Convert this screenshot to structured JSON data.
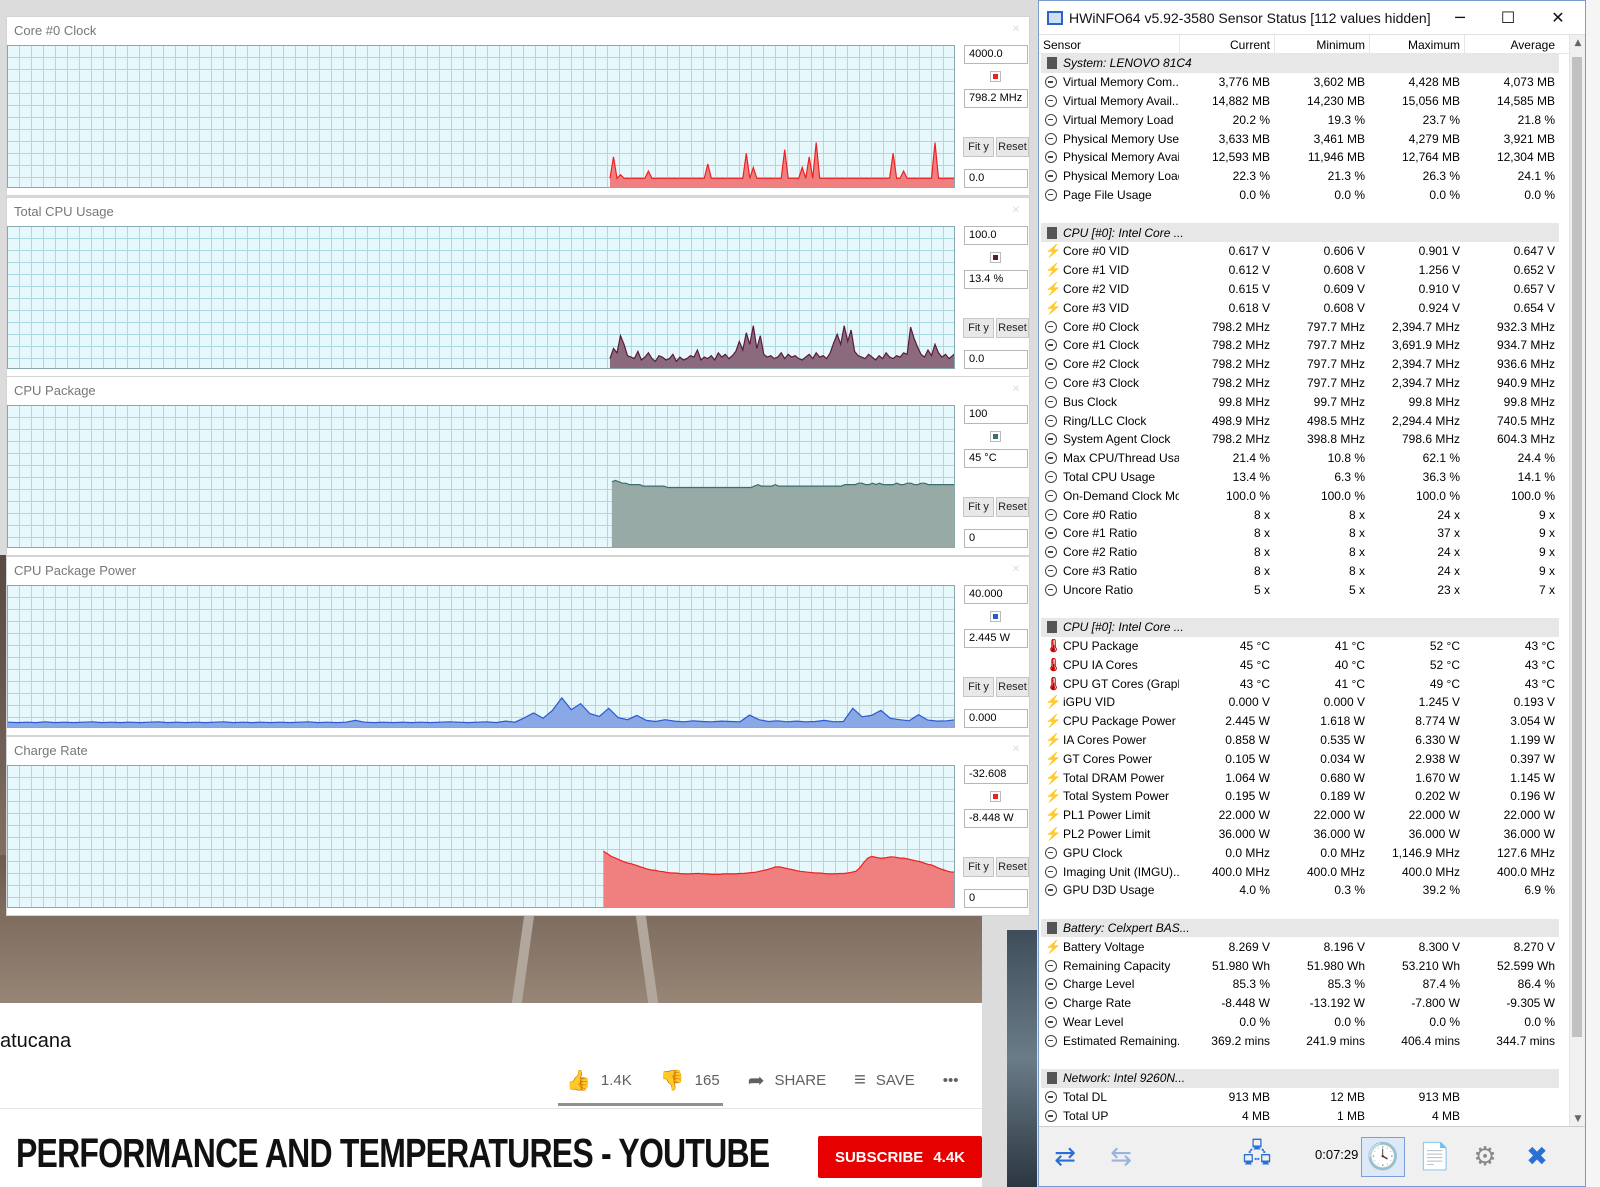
{
  "youtube": {
    "channel": "atucana",
    "likes": "1.4K",
    "dislikes": "165",
    "share": "SHARE",
    "save": "SAVE",
    "more": "•••",
    "page_title": "PERFORMANCE AND TEMPERATURES - YOUTUBE",
    "subscribe": "SUBSCRIBE",
    "subscribers": "4.4K"
  },
  "graphs": [
    {
      "title": "Core #0 Clock",
      "max": "4000.0",
      "current": "798.2 MHz",
      "min": "0.0",
      "color": "#ee2020",
      "fill": "#f08080",
      "chart_data": {
        "type": "area",
        "ylim": [
          0,
          4000
        ],
        "start_x": 0.635,
        "values": [
          300,
          900,
          300,
          400,
          300,
          300,
          300,
          300,
          300,
          300,
          300,
          500,
          300,
          300,
          300,
          300,
          300,
          300,
          300,
          300,
          300,
          300,
          300,
          300,
          300,
          300,
          300,
          300,
          700,
          300,
          300,
          300,
          300,
          300,
          300,
          300,
          300,
          300,
          300,
          1000,
          300,
          600,
          300,
          300,
          300,
          300,
          300,
          300,
          300,
          300,
          1100,
          300,
          300,
          300,
          300,
          600,
          300,
          900,
          300,
          1300,
          300,
          300,
          300,
          300,
          300,
          300,
          300,
          300,
          300,
          300,
          300,
          300,
          300,
          300,
          300,
          300,
          300,
          300,
          300,
          300,
          300,
          1000,
          300,
          300,
          500,
          300,
          300,
          300,
          300,
          300,
          300,
          300,
          300,
          1300,
          300,
          300,
          300,
          300,
          300,
          300
        ]
      }
    },
    {
      "title": "Total CPU Usage",
      "max": "100.0",
      "current": "13.4 %",
      "min": "0.0",
      "color": "#5a1a3a",
      "fill": "#8c6a7e",
      "chart_data": {
        "type": "area",
        "ylim": [
          0,
          100
        ],
        "start_x": 0.635,
        "values": [
          8,
          15,
          12,
          24,
          18,
          10,
          9,
          8,
          13,
          7,
          9,
          12,
          8,
          6,
          10,
          9,
          7,
          8,
          11,
          6,
          9,
          7,
          8,
          10,
          9,
          14,
          7,
          9,
          8,
          10,
          7,
          12,
          9,
          11,
          8,
          10,
          13,
          20,
          14,
          26,
          18,
          31,
          15,
          24,
          11,
          9,
          10,
          8,
          9,
          12,
          8,
          11,
          9,
          10,
          8,
          7,
          9,
          11,
          8,
          12,
          9,
          10,
          8,
          12,
          19,
          25,
          18,
          31,
          20,
          28,
          13,
          10,
          9,
          8,
          11,
          9,
          7,
          10,
          8,
          12,
          9,
          8,
          10,
          9,
          12,
          11,
          30,
          22,
          16,
          11,
          9,
          14,
          10,
          18,
          12,
          9,
          11,
          8,
          10,
          12
        ]
      }
    },
    {
      "title": "CPU Package",
      "max": "100",
      "current": "45 °C",
      "min": "0",
      "color": "#3c7070",
      "fill": "#97aaa6",
      "chart_data": {
        "type": "area",
        "ylim": [
          0,
          100
        ],
        "start_x": 0.637,
        "values": [
          47,
          48,
          47,
          46,
          46,
          45,
          45,
          45,
          45,
          44,
          44,
          44,
          44,
          44,
          44,
          44,
          43,
          43,
          43,
          43,
          43,
          43,
          43,
          43,
          43,
          43,
          43,
          43,
          43,
          43,
          43,
          43,
          43,
          43,
          43,
          43,
          43,
          43,
          43,
          43,
          43,
          44,
          45,
          44,
          44,
          44,
          44,
          45,
          44,
          44,
          44,
          44,
          44,
          44,
          44,
          44,
          44,
          44,
          44,
          44,
          44,
          44,
          44,
          44,
          44,
          44,
          44,
          45,
          45,
          45,
          45,
          46,
          46,
          45,
          45,
          46,
          45,
          46,
          45,
          45,
          45,
          45,
          46,
          45,
          45,
          46,
          46,
          45,
          45,
          46,
          46,
          45,
          45,
          45,
          45,
          45,
          45,
          45,
          45,
          45
        ]
      }
    },
    {
      "title": "CPU Package Power",
      "max": "40.000",
      "current": "2.445 W",
      "min": "0.000",
      "color": "#2a5ad0",
      "fill": "#8aa8e6",
      "chart_data": {
        "type": "area",
        "ylim": [
          0,
          40
        ],
        "start_x": 0.0,
        "values": [
          1.9,
          1.8,
          1.9,
          1.8,
          2.0,
          1.8,
          1.9,
          1.8,
          1.9,
          2.0,
          1.8,
          1.9,
          1.8,
          1.9,
          1.8,
          1.9,
          2.0,
          1.8,
          1.9,
          1.8,
          1.9,
          1.8,
          1.9,
          2.0,
          1.8,
          1.9,
          1.8,
          1.9,
          1.8,
          1.9,
          1.8,
          1.9,
          2.0,
          1.8,
          1.9,
          1.8,
          1.9,
          2.4,
          1.9,
          1.8,
          1.9,
          1.8,
          1.9,
          1.8,
          1.9,
          1.8,
          1.9,
          2.0,
          1.9,
          1.8,
          1.9,
          2.0,
          1.8,
          2.2,
          1.9,
          3.1,
          4.5,
          3.0,
          5.2,
          8.7,
          5.4,
          7.1,
          4.3,
          3.5,
          5.8,
          3.2,
          2.6,
          3.8,
          2.4,
          2.1,
          2.6,
          2.2,
          2.0,
          2.3,
          2.1,
          2.0,
          2.2,
          2.1,
          2.0,
          3.9,
          2.6,
          2.1,
          2.3,
          2.0,
          2.2,
          2.0,
          2.1,
          2.4,
          2.0,
          2.1,
          5.8,
          3.4,
          3.8,
          5.2,
          3.0,
          2.6,
          2.3,
          4.0,
          2.5,
          2.2,
          2.3,
          2.6
        ]
      }
    },
    {
      "title": "Charge Rate",
      "max": "-32.608",
      "current": "-8.448 W",
      "min": "0",
      "color": "#ee2020",
      "fill": "#f08080",
      "chart_data": {
        "type": "area",
        "ylim": [
          0,
          32.608
        ],
        "start_x": 0.628,
        "values": [
          13.2,
          12.6,
          12.0,
          11.6,
          11.2,
          10.8,
          10.5,
          10.3,
          10.0,
          9.7,
          9.4,
          9.1,
          8.9,
          8.8,
          8.6,
          8.5,
          8.3,
          8.2,
          8.2,
          8.1,
          8.0,
          8.0,
          8.0,
          8.1,
          8.1,
          8.0,
          8.0,
          7.9,
          7.9,
          7.9,
          8.0,
          8.0,
          8.0,
          8.0,
          8.1,
          8.1,
          8.2,
          8.3,
          8.4,
          8.6,
          8.8,
          9.0,
          9.3,
          9.6,
          9.6,
          9.4,
          9.2,
          9.0,
          8.8,
          8.6,
          8.5,
          8.4,
          8.3,
          8.2,
          8.2,
          8.1,
          8.0,
          8.0,
          8.0,
          8.1,
          8.1,
          8.2,
          8.4,
          8.6,
          9.4,
          10.6,
          11.6,
          12.0,
          11.8,
          11.6,
          11.6,
          11.8,
          11.9,
          11.8,
          11.6,
          11.6,
          11.4,
          11.2,
          11.0,
          10.8,
          10.5,
          10.2,
          10.0,
          9.6,
          9.2,
          8.9,
          8.6,
          8.4,
          8.5
        ]
      }
    }
  ],
  "buttons": {
    "fit_y": "Fit y",
    "reset": "Reset"
  },
  "hwinfo": {
    "title": "HWiNFO64 v5.92-3580 Sensor Status [112 values hidden]",
    "columns": [
      "Sensor",
      "Current",
      "Minimum",
      "Maximum",
      "Average"
    ],
    "rows": [
      {
        "type": "group",
        "name": "System: LENOVO 81C4"
      },
      {
        "icon": "clock",
        "name": "Virtual Memory Com...",
        "cur": "3,776 MB",
        "min": "3,602 MB",
        "max": "4,428 MB",
        "avg": "4,073 MB"
      },
      {
        "icon": "clock",
        "name": "Virtual Memory Avail...",
        "cur": "14,882 MB",
        "min": "14,230 MB",
        "max": "15,056 MB",
        "avg": "14,585 MB"
      },
      {
        "icon": "clock",
        "name": "Virtual Memory Load",
        "cur": "20.2 %",
        "min": "19.3 %",
        "max": "23.7 %",
        "avg": "21.8 %"
      },
      {
        "icon": "clock",
        "name": "Physical Memory Used",
        "cur": "3,633 MB",
        "min": "3,461 MB",
        "max": "4,279 MB",
        "avg": "3,921 MB"
      },
      {
        "icon": "clock",
        "name": "Physical Memory Avai...",
        "cur": "12,593 MB",
        "min": "11,946 MB",
        "max": "12,764 MB",
        "avg": "12,304 MB"
      },
      {
        "icon": "clock",
        "name": "Physical Memory Load",
        "cur": "22.3 %",
        "min": "21.3 %",
        "max": "26.3 %",
        "avg": "24.1 %"
      },
      {
        "icon": "clock",
        "name": "Page File Usage",
        "cur": "0.0 %",
        "min": "0.0 %",
        "max": "0.0 %",
        "avg": "0.0 %"
      },
      {
        "type": "spacer"
      },
      {
        "type": "group",
        "name": "CPU [#0]: Intel Core ..."
      },
      {
        "icon": "bolt",
        "name": "Core #0 VID",
        "cur": "0.617 V",
        "min": "0.606 V",
        "max": "0.901 V",
        "avg": "0.647 V"
      },
      {
        "icon": "bolt",
        "name": "Core #1 VID",
        "cur": "0.612 V",
        "min": "0.608 V",
        "max": "1.256 V",
        "avg": "0.652 V"
      },
      {
        "icon": "bolt",
        "name": "Core #2 VID",
        "cur": "0.615 V",
        "min": "0.609 V",
        "max": "0.910 V",
        "avg": "0.657 V"
      },
      {
        "icon": "bolt",
        "name": "Core #3 VID",
        "cur": "0.618 V",
        "min": "0.608 V",
        "max": "0.924 V",
        "avg": "0.654 V"
      },
      {
        "icon": "clock",
        "name": "Core #0 Clock",
        "cur": "798.2 MHz",
        "min": "797.7 MHz",
        "max": "2,394.7 MHz",
        "avg": "932.3 MHz"
      },
      {
        "icon": "clock",
        "name": "Core #1 Clock",
        "cur": "798.2 MHz",
        "min": "797.7 MHz",
        "max": "3,691.9 MHz",
        "avg": "934.7 MHz"
      },
      {
        "icon": "clock",
        "name": "Core #2 Clock",
        "cur": "798.2 MHz",
        "min": "797.7 MHz",
        "max": "2,394.7 MHz",
        "avg": "936.6 MHz"
      },
      {
        "icon": "clock",
        "name": "Core #3 Clock",
        "cur": "798.2 MHz",
        "min": "797.7 MHz",
        "max": "2,394.7 MHz",
        "avg": "940.9 MHz"
      },
      {
        "icon": "clock",
        "name": "Bus Clock",
        "cur": "99.8 MHz",
        "min": "99.7 MHz",
        "max": "99.8 MHz",
        "avg": "99.8 MHz"
      },
      {
        "icon": "clock",
        "name": "Ring/LLC Clock",
        "cur": "498.9 MHz",
        "min": "498.5 MHz",
        "max": "2,294.4 MHz",
        "avg": "740.5 MHz"
      },
      {
        "icon": "clock",
        "name": "System Agent Clock",
        "cur": "798.2 MHz",
        "min": "398.8 MHz",
        "max": "798.6 MHz",
        "avg": "604.3 MHz"
      },
      {
        "icon": "clock",
        "name": "Max CPU/Thread Usage",
        "cur": "21.4 %",
        "min": "10.8 %",
        "max": "62.1 %",
        "avg": "24.4 %"
      },
      {
        "icon": "clock",
        "name": "Total CPU Usage",
        "cur": "13.4 %",
        "min": "6.3 %",
        "max": "36.3 %",
        "avg": "14.1 %"
      },
      {
        "icon": "clock",
        "name": "On-Demand Clock Mo...",
        "cur": "100.0 %",
        "min": "100.0 %",
        "max": "100.0 %",
        "avg": "100.0 %"
      },
      {
        "icon": "clock",
        "name": "Core #0 Ratio",
        "cur": "8 x",
        "min": "8 x",
        "max": "24 x",
        "avg": "9 x"
      },
      {
        "icon": "clock",
        "name": "Core #1 Ratio",
        "cur": "8 x",
        "min": "8 x",
        "max": "37 x",
        "avg": "9 x"
      },
      {
        "icon": "clock",
        "name": "Core #2 Ratio",
        "cur": "8 x",
        "min": "8 x",
        "max": "24 x",
        "avg": "9 x"
      },
      {
        "icon": "clock",
        "name": "Core #3 Ratio",
        "cur": "8 x",
        "min": "8 x",
        "max": "24 x",
        "avg": "9 x"
      },
      {
        "icon": "clock",
        "name": "Uncore Ratio",
        "cur": "5 x",
        "min": "5 x",
        "max": "23 x",
        "avg": "7 x"
      },
      {
        "type": "spacer"
      },
      {
        "type": "group",
        "name": "CPU [#0]: Intel Core ..."
      },
      {
        "icon": "temp",
        "name": "CPU Package",
        "cur": "45 °C",
        "min": "41 °C",
        "max": "52 °C",
        "avg": "43 °C"
      },
      {
        "icon": "temp",
        "name": "CPU IA Cores",
        "cur": "45 °C",
        "min": "40 °C",
        "max": "52 °C",
        "avg": "43 °C"
      },
      {
        "icon": "temp",
        "name": "CPU GT Cores (Graph...",
        "cur": "43 °C",
        "min": "41 °C",
        "max": "49 °C",
        "avg": "43 °C"
      },
      {
        "icon": "bolt",
        "name": "iGPU VID",
        "cur": "0.000 V",
        "min": "0.000 V",
        "max": "1.245 V",
        "avg": "0.193 V"
      },
      {
        "icon": "bolt",
        "name": "CPU Package Power",
        "cur": "2.445 W",
        "min": "1.618 W",
        "max": "8.774 W",
        "avg": "3.054 W"
      },
      {
        "icon": "bolt",
        "name": "IA Cores Power",
        "cur": "0.858 W",
        "min": "0.535 W",
        "max": "6.330 W",
        "avg": "1.199 W"
      },
      {
        "icon": "bolt",
        "name": "GT Cores Power",
        "cur": "0.105 W",
        "min": "0.034 W",
        "max": "2.938 W",
        "avg": "0.397 W"
      },
      {
        "icon": "bolt",
        "name": "Total DRAM Power",
        "cur": "1.064 W",
        "min": "0.680 W",
        "max": "1.670 W",
        "avg": "1.145 W"
      },
      {
        "icon": "bolt",
        "name": "Total System Power",
        "cur": "0.195 W",
        "min": "0.189 W",
        "max": "0.202 W",
        "avg": "0.196 W"
      },
      {
        "icon": "bolt",
        "name": "PL1 Power Limit",
        "cur": "22.000 W",
        "min": "22.000 W",
        "max": "22.000 W",
        "avg": "22.000 W"
      },
      {
        "icon": "bolt",
        "name": "PL2 Power Limit",
        "cur": "36.000 W",
        "min": "36.000 W",
        "max": "36.000 W",
        "avg": "36.000 W"
      },
      {
        "icon": "clock",
        "name": "GPU Clock",
        "cur": "0.0 MHz",
        "min": "0.0 MHz",
        "max": "1,146.9 MHz",
        "avg": "127.6 MHz"
      },
      {
        "icon": "clock",
        "name": "Imaging Unit (IMGU)...",
        "cur": "400.0 MHz",
        "min": "400.0 MHz",
        "max": "400.0 MHz",
        "avg": "400.0 MHz"
      },
      {
        "icon": "clock",
        "name": "GPU D3D Usage",
        "cur": "4.0 %",
        "min": "0.3 %",
        "max": "39.2 %",
        "avg": "6.9 %"
      },
      {
        "type": "spacer"
      },
      {
        "type": "group",
        "name": "Battery: Celxpert BAS..."
      },
      {
        "icon": "bolt",
        "name": "Battery Voltage",
        "cur": "8.269 V",
        "min": "8.196 V",
        "max": "8.300 V",
        "avg": "8.270 V"
      },
      {
        "icon": "clock",
        "name": "Remaining Capacity",
        "cur": "51.980 Wh",
        "min": "51.980 Wh",
        "max": "53.210 Wh",
        "avg": "52.599 Wh"
      },
      {
        "icon": "clock",
        "name": "Charge Level",
        "cur": "85.3 %",
        "min": "85.3 %",
        "max": "87.4 %",
        "avg": "86.4 %"
      },
      {
        "icon": "clock",
        "name": "Charge Rate",
        "cur": "-8.448 W",
        "min": "-13.192 W",
        "max": "-7.800 W",
        "avg": "-9.305 W"
      },
      {
        "icon": "clock",
        "name": "Wear Level",
        "cur": "0.0 %",
        "min": "0.0 %",
        "max": "0.0 %",
        "avg": "0.0 %"
      },
      {
        "icon": "clock",
        "name": "Estimated Remaining...",
        "cur": "369.2 mins",
        "min": "241.9 mins",
        "max": "406.4 mins",
        "avg": "344.7 mins"
      },
      {
        "type": "spacer"
      },
      {
        "type": "group",
        "name": "Network: Intel 9260N..."
      },
      {
        "icon": "clock",
        "name": "Total DL",
        "cur": "913 MB",
        "min": "12 MB",
        "max": "913 MB",
        "avg": ""
      },
      {
        "icon": "clock",
        "name": "Total UP",
        "cur": "4 MB",
        "min": "1 MB",
        "max": "4 MB",
        "avg": ""
      }
    ],
    "timer": "0:07:29"
  }
}
